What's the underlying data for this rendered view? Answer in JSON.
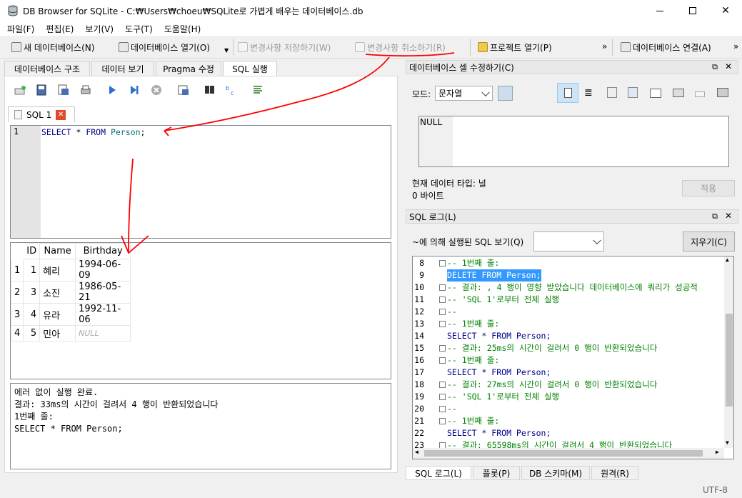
{
  "window": {
    "title": "DB Browser for SQLite - C:₩Users₩choeu₩SQLite로 가볍게 배우는 데이터베이스.db"
  },
  "menu": [
    "파일(F)",
    "편집(E)",
    "보기(V)",
    "도구(T)",
    "도움말(H)"
  ],
  "toolbar": {
    "new_db": "새 데이터베이스(N)",
    "open_db": "데이터베이스 열기(O)",
    "write_changes": "변경사항 저장하기(W)",
    "revert_changes": "변경사항 취소하기(R)",
    "open_project": "프로젝트 열기(P)",
    "attach_db": "데이터베이스 연결(A)",
    "overflow": "»"
  },
  "main_tabs": [
    "데이터베이스 구조",
    "데이터 보기",
    "Pragma 수정",
    "SQL 실행"
  ],
  "sql_tab": {
    "label": "SQL 1"
  },
  "editor": {
    "line_no": "1",
    "kw1": "SELECT",
    "star": " * ",
    "kw2": "FROM",
    "table": " Person",
    "end": ";"
  },
  "results": {
    "columns": [
      "ID",
      "Name",
      "Birthday"
    ],
    "rows": [
      {
        "row": "1",
        "id": "1",
        "name": "혜리",
        "birthday": "1994-06-09"
      },
      {
        "row": "2",
        "id": "3",
        "name": "소진",
        "birthday": "1986-05-21"
      },
      {
        "row": "3",
        "id": "4",
        "name": "유라",
        "birthday": "1992-11-06"
      },
      {
        "row": "4",
        "id": "5",
        "name": "민아",
        "birthday": "NULL"
      }
    ]
  },
  "messages": [
    "에러 없이 실행 완료.",
    "결과: 33ms의 시간이 걸려서 4 행이 반환되었습니다",
    "1번째 줄:",
    "SELECT * FROM Person;"
  ],
  "edit_cell": {
    "title": "데이터베이스 셀 수정하기(C)",
    "mode_label": "모드:",
    "mode_value": "문자열",
    "cell_value": "NULL",
    "type_label": "현재 데이터 타입: 널",
    "size_label": "0 바이트",
    "apply": "적용"
  },
  "sql_log": {
    "title": "SQL 로그(L)",
    "submitted_by_label": "~에 의해 실행된 SQL 보기(Q)",
    "clear": "지우기(C)",
    "lines": [
      {
        "n": "8",
        "t": "-- 1번째 줄:"
      },
      {
        "n": "9",
        "t": "DELETE FROM Person;"
      },
      {
        "n": "10",
        "t": "-- 결과: , 4 행이 영향 받았습니다 데이터베이스에 쿼리가 성공적"
      },
      {
        "n": "11",
        "t": "-- 'SQL 1'로부터 전체 실행"
      },
      {
        "n": "12",
        "t": "--"
      },
      {
        "n": "13",
        "t": "-- 1번째 줄:"
      },
      {
        "n": "14",
        "t": "SELECT * FROM Person;"
      },
      {
        "n": "15",
        "t": "-- 결과: 25ms의 시간이 걸려서 0 행이 반환되었습니다"
      },
      {
        "n": "16",
        "t": "-- 1번째 줄:"
      },
      {
        "n": "17",
        "t": "SELECT * FROM Person;"
      },
      {
        "n": "18",
        "t": "-- 결과: 27ms의 시간이 걸려서 0 행이 반환되었습니다"
      },
      {
        "n": "19",
        "t": "-- 'SQL 1'로부터 전체 실행"
      },
      {
        "n": "20",
        "t": "--"
      },
      {
        "n": "21",
        "t": "-- 1번째 줄:"
      },
      {
        "n": "22",
        "t": "SELECT * FROM Person;"
      },
      {
        "n": "23",
        "t": "-- 결과: 65598ms의 시간이 걸려서 4 행이 반환되었습니다"
      }
    ]
  },
  "bottom_tabs": [
    "SQL 로그(L)",
    "플롯(P)",
    "DB 스키마(M)",
    "원격(R)"
  ],
  "status": {
    "encoding": "UTF-8"
  },
  "annotation_color": "#ff0000"
}
